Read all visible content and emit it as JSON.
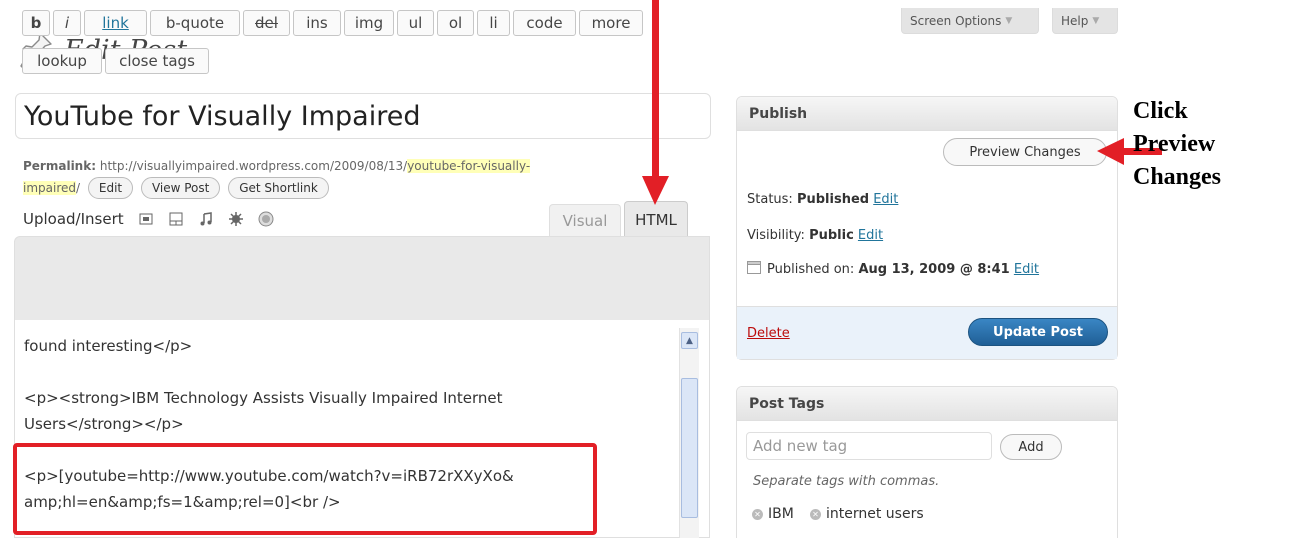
{
  "header": {
    "title": "Edit Post",
    "screen_options": "Screen Options",
    "help": "Help"
  },
  "post": {
    "title": "YouTube for Visually Impaired",
    "permalink_label": "Permalink:",
    "permalink_base": "http://visuallyimpaired.wordpress.com/2009/08/13/",
    "permalink_slug_1": "youtube-for-visually-",
    "permalink_slug_2": "impaired",
    "permalink_tail": "/",
    "edit_label": "Edit",
    "view_post_label": "View Post",
    "shortlink_label": "Get Shortlink"
  },
  "upload": {
    "label": "Upload/Insert",
    "icons": [
      "image-icon",
      "video-icon",
      "audio-icon",
      "media-icon",
      "circle-icon"
    ]
  },
  "editor_tabs": {
    "visual": "Visual",
    "html": "HTML"
  },
  "quicktags": {
    "row1": [
      "b",
      "i",
      "link",
      "b-quote",
      "del",
      "ins",
      "img",
      "ul",
      "ol",
      "li",
      "code",
      "more"
    ],
    "row2": [
      "lookup",
      "close tags"
    ]
  },
  "editor": {
    "lines": [
      "found interesting</p>",
      "<p><strong>IBM Technology Assists Visually Impaired Internet",
      "Users</strong></p>",
      "<p>[youtube=http://www.youtube.com/watch?v=iRB72rXXyXo&",
      "amp;hl=en&amp;fs=1&amp;rel=0]<br />"
    ]
  },
  "publish": {
    "title": "Publish",
    "preview_label": "Preview Changes",
    "status_label": "Status:",
    "status_value": "Published",
    "visibility_label": "Visibility:",
    "visibility_value": "Public",
    "published_label": "Published on:",
    "published_value": "Aug 13, 2009 @ 8:41",
    "edit_link": "Edit",
    "delete_label": "Delete",
    "update_label": "Update Post"
  },
  "tags": {
    "title": "Post Tags",
    "input_placeholder": "Add new tag",
    "add_label": "Add",
    "hint": "Separate tags with commas.",
    "items": [
      "IBM",
      "internet users"
    ]
  },
  "annotation": {
    "line1": "Click",
    "line2": "Preview",
    "line3": "Changes"
  },
  "colors": {
    "annotation_red": "#e21f26",
    "link_blue": "#21759b",
    "update_button": "#2a74b0",
    "permalink_highlight": "#ffffb8"
  }
}
